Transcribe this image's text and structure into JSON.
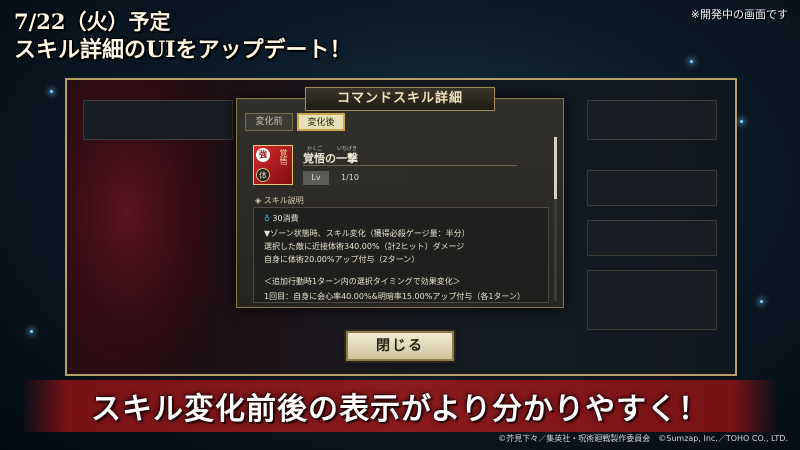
{
  "headline": {
    "date": "7/22（火）予定",
    "sub": "スキル詳細のUIをアップデート！"
  },
  "dev_note": "※開発中の画面です",
  "dialog": {
    "title": "コマンドスキル詳細",
    "tabs": {
      "before": "変化前",
      "after": "変化後"
    },
    "skill": {
      "ruby_1": "かくご",
      "ruby_2": "いちげき",
      "name": "覚悟の一撃",
      "lv_label": "Lv",
      "lv_value": "1/10",
      "icon_badge_top": "強",
      "icon_badge_bottom": "体",
      "icon_kanji": "覚悟"
    },
    "section_label": "スキル説明",
    "description": {
      "cost": "30消費",
      "line1": "▼ゾーン状態時、スキル変化（獲得必殺ゲージ量：半分）",
      "line2": "選択した敵に近接体術340.00%（計2ヒット）ダメージ",
      "line3": "自身に体術20.00%アップ付与（2ターン）",
      "line4": "＜追加行動時1ターン内の選択タイミングで効果変化＞",
      "line5": "1回目：自身に会心率40.00%&明暗率15.00%アップ付与（各1ターン）"
    }
  },
  "close_button": "閉じる",
  "banner": "スキル変化前後の表示がより分かりやすく！",
  "copyright": "©芥見下々／集英社・呪術廻戦製作委員会　©Sumzap, Inc.／TOHO CO., LTD."
}
